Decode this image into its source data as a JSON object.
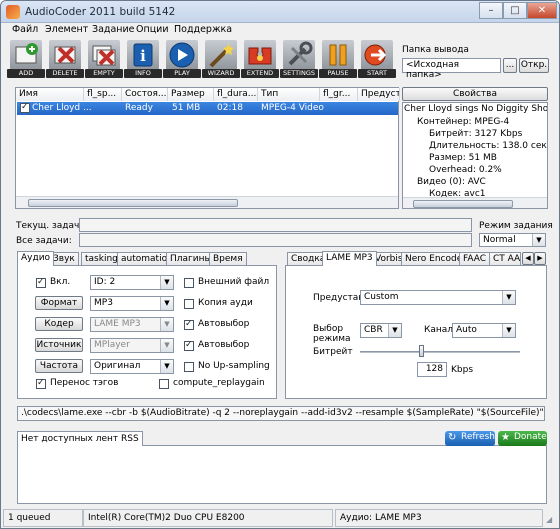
{
  "window": {
    "title": "AudioCoder 2011 build 5142"
  },
  "menu": [
    "Файл",
    "Элемент",
    "Задание",
    "Опции",
    "Поддержка"
  ],
  "toolbar": [
    {
      "label": "ADD",
      "icon": "add-icon",
      "color": "#2d9a2d"
    },
    {
      "label": "DELETE",
      "icon": "delete-icon",
      "color": "#c0302a"
    },
    {
      "label": "EMPTY",
      "icon": "empty-icon",
      "color": "#c0302a"
    },
    {
      "label": "INFO",
      "icon": "info-icon",
      "color": "#1a5fb0"
    },
    {
      "label": "PLAY",
      "icon": "play-icon",
      "color": "#1a5fb0"
    },
    {
      "label": "WIZARD",
      "icon": "wizard-icon",
      "color": "#d9b13a"
    },
    {
      "label": "EXTEND",
      "icon": "extend-icon",
      "color": "#d83a24"
    },
    {
      "label": "SETTINGS",
      "icon": "settings-icon",
      "color": "#6e7680"
    },
    {
      "label": "PAUSE",
      "icon": "pause-icon",
      "color": "#f0a020"
    },
    {
      "label": "START",
      "icon": "start-icon",
      "color": "#e04a20"
    }
  ],
  "output": {
    "label": "Папка вывода",
    "value": "<Исходная папка>",
    "browse": "...",
    "open": "Откр."
  },
  "filelist": {
    "columns": [
      "Имя",
      "fl_sp...",
      "Состоя...",
      "Размер",
      "fl_dura...",
      "Тип",
      "fl_gr...",
      "Предуста"
    ],
    "rows": [
      {
        "name": "Cher Lloyd ...",
        "status": "Ready",
        "size": "51 MB",
        "duration": "02:18",
        "type": "MPEG-4 Video",
        "checked": true
      }
    ]
  },
  "props": {
    "button": "Свойства",
    "title": "Cher Lloyd sings No Diggity  Shout.n",
    "lines": [
      "Контейнер: MPEG-4",
      "Битрейт: 3127 Kbps",
      "Длительность: 138.0 сек",
      "Размер: 51 MB",
      "Overhead: 0.2%",
      "Видео (0): AVC",
      "Кодек: avc1"
    ]
  },
  "task": {
    "current": "Текущ. задача:",
    "all": "Все задачи:",
    "mode_label": "Режим задания",
    "mode": "Normal"
  },
  "left_tabs": [
    "Аудио",
    "Звук",
    "tasking",
    "automation",
    "Плагины",
    "Время"
  ],
  "audio": {
    "enable_label": "Вкл.",
    "id_value": "ID: 2",
    "format_btn": "Формат",
    "format_value": "MP3",
    "codec_btn": "Кодер",
    "codec_value": "LAME MP3",
    "source_btn": "Источник",
    "source_value": "MPlayer",
    "freq_btn": "Частота",
    "freq_value": "Оригинал",
    "external": "Внешний файл",
    "copy": "Копия ауди",
    "auto1": "Автовыбор",
    "auto2": "Автовыбор",
    "noupsample": "No Up-sampling",
    "tags": "Перенос тэгов",
    "replaygain": "compute_replaygain"
  },
  "right_tabs": [
    "Сводка",
    "LAME MP3",
    "Vorbis",
    "Nero Encoder",
    "FAAC",
    "CT AAC"
  ],
  "lame": {
    "preset_label": "Предустан",
    "preset_value": "Custom",
    "mode_label": "Выбор режима",
    "mode_value": "CBR",
    "channel_label": "Канал",
    "channel_value": "Auto",
    "bitrate_label": "Битрейт",
    "bitrate_value": "128",
    "bitrate_unit": "Kbps"
  },
  "command": ".\\codecs\\lame.exe --cbr -b $(AudioBitrate) -q 2 --noreplaygain --add-id3v2 --resample $(SampleRate) \"$(SourceFile)\" \"$(DestFileAudio)\"",
  "rss": {
    "tab": "Нет доступных лент RSS",
    "refresh": "Refresh",
    "donate": "Donate"
  },
  "status": {
    "queue": "1 queued",
    "cpu": "Intel(R) Core(TM)2 Duo CPU E8200",
    "audio": "Аудио: LAME MP3"
  }
}
